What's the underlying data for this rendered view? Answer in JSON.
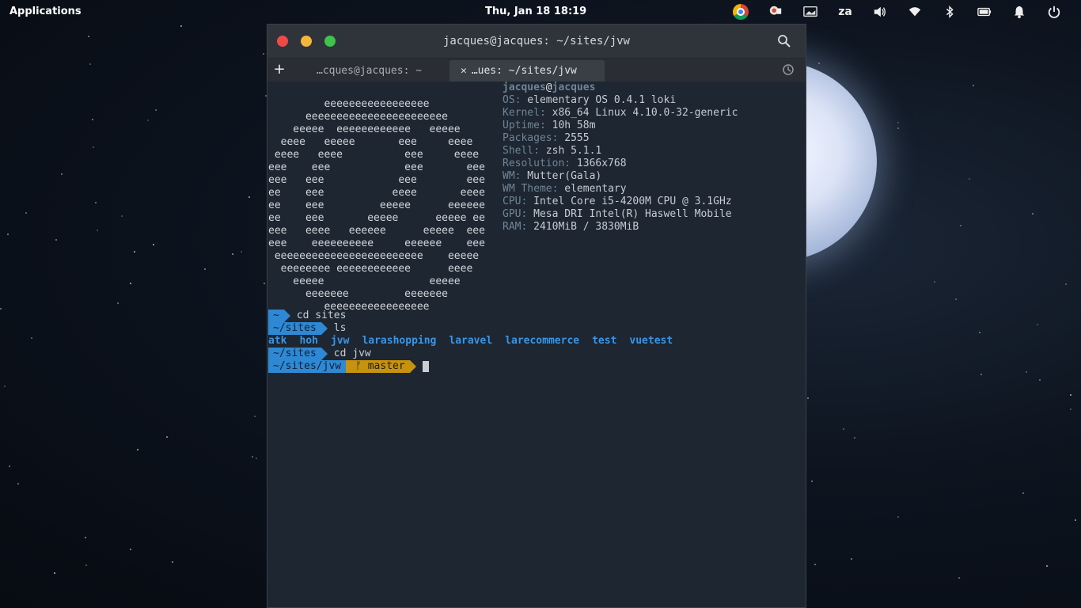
{
  "panel": {
    "applications_label": "Applications",
    "clock": "Thu, Jan 18  18:19",
    "keyboard_layout": "za",
    "indicator_icons": [
      "chrome-icon",
      "notes-icon",
      "display-icon",
      "keyboard-layout",
      "volume-icon",
      "wifi-icon",
      "bluetooth-icon",
      "battery-icon",
      "notifications-icon",
      "power-icon"
    ]
  },
  "window": {
    "title": "jacques@jacques: ~/sites/jvw",
    "tabs": [
      {
        "label": "…cques@jacques: ~",
        "active": false
      },
      {
        "label": "…ues: ~/sites/jvw",
        "active": true
      }
    ],
    "new_tab_label": "+",
    "close_tab_glyph": "✕"
  },
  "terminal": {
    "logo_lines": [
      "         eeeeeeeeeeeeeeeee",
      "      eeeeeeeeeeeeeeeeeeeeeee",
      "    eeeee  eeeeeeeeeeee   eeeee",
      "  eeee   eeeee       eee     eeee",
      " eeee   eeee          eee     eeee",
      "eee    eee            eee       eee",
      "eee   eee            eee        eee",
      "ee    eee           eeee       eeee",
      "ee    eee         eeeee      eeeeee",
      "ee    eee       eeeee      eeeee ee",
      "eee   eeee   eeeeee      eeeee  eee",
      "eee    eeeeeeeeee     eeeeee    eee",
      " eeeeeeeeeeeeeeeeeeeeeeee    eeeee",
      "  eeeeeeee eeeeeeeeeeee      eeee",
      "    eeeee                 eeeee",
      "      eeeeeee         eeeeeee",
      "         eeeeeeeeeeeeeeeee"
    ],
    "user": "jacques",
    "at": "@",
    "host": "jacques",
    "info": [
      {
        "label": "OS:",
        "value": " elementary OS 0.4.1 loki"
      },
      {
        "label": "Kernel:",
        "value": " x86_64 Linux 4.10.0-32-generic"
      },
      {
        "label": "Uptime:",
        "value": " 10h 58m"
      },
      {
        "label": "Packages:",
        "value": " 2555"
      },
      {
        "label": "Shell:",
        "value": " zsh 5.1.1"
      },
      {
        "label": "Resolution:",
        "value": " 1366x768"
      },
      {
        "label": "WM:",
        "value": " Mutter(Gala)"
      },
      {
        "label": "WM Theme:",
        "value": " elementary"
      },
      {
        "label": "CPU:",
        "value": " Intel Core i5-4200M CPU @ 3.1GHz"
      },
      {
        "label": "GPU:",
        "value": " Mesa DRI Intel(R) Haswell Mobile"
      },
      {
        "label": "RAM:",
        "value": " 2410MiB / 3830MiB"
      }
    ],
    "prompts": [
      {
        "dir": "~",
        "cmd": "cd sites"
      },
      {
        "dir": "~/sites",
        "cmd": "ls"
      },
      {
        "dir": "~/sites",
        "cmd": "cd jvw"
      }
    ],
    "ls_output": [
      "atk",
      "hoh",
      "jvw",
      "larashopping",
      "laravel",
      "larecommerce",
      "test",
      "vuetest"
    ],
    "current_prompt": {
      "dir": "~/sites/jvw",
      "branch": "ᚠ master"
    }
  },
  "colors": {
    "prompt_blue": "#2f88d3",
    "prompt_yellow": "#c6930e",
    "dir_listing": "#3a95e6"
  }
}
